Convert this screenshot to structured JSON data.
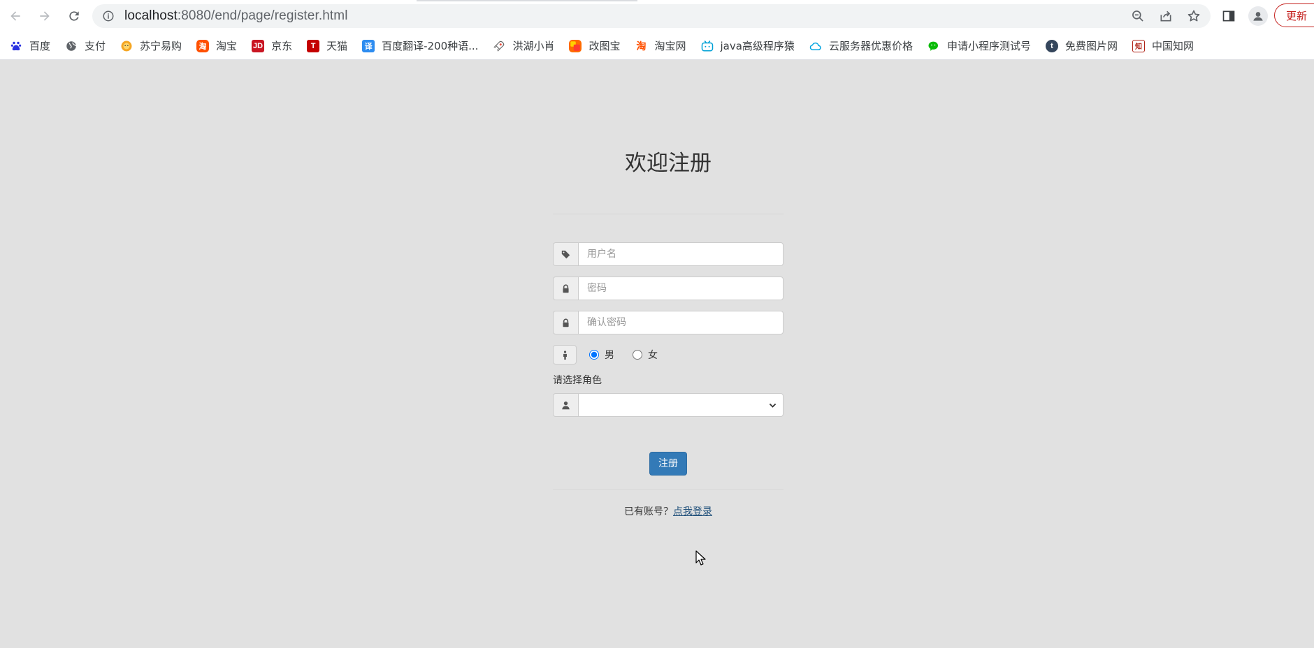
{
  "browser": {
    "url_host": "localhost",
    "url_rest": ":8080/end/page/register.html",
    "update_label": "更新",
    "bookmarks": [
      {
        "label": "百度",
        "icon": "baidu-paw-icon",
        "color": "#2932e1"
      },
      {
        "label": "支付",
        "icon": "globe-icon",
        "color": "#5f6368"
      },
      {
        "label": "苏宁易购",
        "icon": "suning-lion-icon",
        "color": "#f5a623"
      },
      {
        "label": "淘宝",
        "icon": "taobao-icon",
        "color": "#ff5000"
      },
      {
        "label": "京东",
        "icon": "jd-icon",
        "color": "#c91623"
      },
      {
        "label": "天猫",
        "icon": "tmall-icon",
        "color": "#c40000"
      },
      {
        "label": "百度翻译-200种语...",
        "icon": "translate-icon",
        "color": "#2d8cf0"
      },
      {
        "label": "洪湖小肖",
        "icon": "rocket-icon",
        "color": "#666666"
      },
      {
        "label": "改图宝",
        "icon": "gaitubao-icon",
        "color": "#ff6a00"
      },
      {
        "label": "淘宝网",
        "icon": "taobao-icon",
        "color": "#ff5000"
      },
      {
        "label": "java高级程序猿",
        "icon": "bilibili-icon",
        "color": "#00a1d6"
      },
      {
        "label": "云服务器优惠价格",
        "icon": "cloud-icon",
        "color": "#00a3e0"
      },
      {
        "label": "申请小程序测试号",
        "icon": "wechat-icon",
        "color": "#09bb07"
      },
      {
        "label": "免费图片网",
        "icon": "tumblr-icon",
        "color": "#35465c"
      },
      {
        "label": "中国知网",
        "icon": "cnki-icon",
        "color": "#b02418"
      }
    ]
  },
  "form": {
    "title": "欢迎注册",
    "username_placeholder": "用户名",
    "password_placeholder": "密码",
    "confirm_placeholder": "确认密码",
    "gender_male": "男",
    "gender_female": "女",
    "gender_selected": "男",
    "role_label": "请选择角色",
    "role_value": "",
    "submit_label": "注册",
    "login_prompt": "已有账号？",
    "login_link": "点我登录"
  },
  "colors": {
    "page_bg": "#e1e1e1",
    "primary": "#337ab7",
    "link": "#23527c"
  }
}
